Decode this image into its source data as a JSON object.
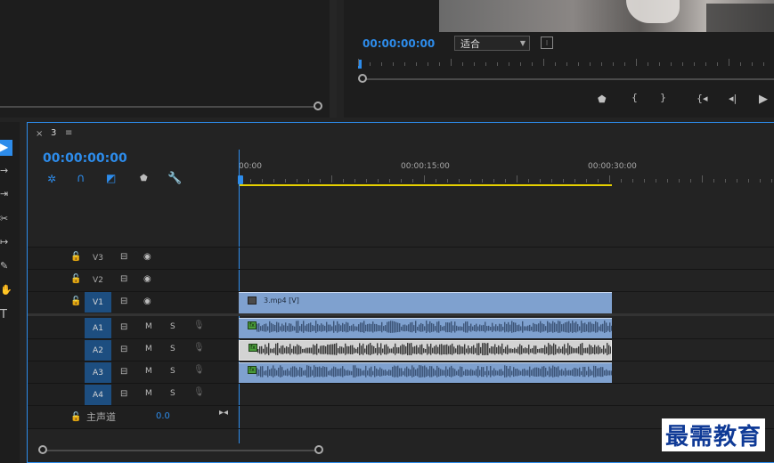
{
  "program": {
    "timecode": "00:00:00:00",
    "zoom_select": "适合",
    "transport": [
      "marker-icon",
      "mark-in-icon",
      "mark-out-icon",
      "go-to-in-icon",
      "step-back-icon",
      "play-icon"
    ]
  },
  "timeline": {
    "tab_close": "×",
    "tab_name": "3",
    "tab_menu": "≡",
    "timecode": "00:00:00:00",
    "ruler": [
      "00:00",
      "00:00:15:00",
      "00:00:30:00"
    ],
    "video_tracks": [
      {
        "name": "V3",
        "active": false
      },
      {
        "name": "V2",
        "active": false
      },
      {
        "name": "V1",
        "active": true
      }
    ],
    "audio_tracks": [
      {
        "name": "A1",
        "active": true,
        "m": "M",
        "s": "S"
      },
      {
        "name": "A2",
        "active": true,
        "m": "M",
        "s": "S"
      },
      {
        "name": "A3",
        "active": true,
        "m": "M",
        "s": "S"
      },
      {
        "name": "A4",
        "active": true,
        "m": "M",
        "s": "S"
      }
    ],
    "master_label": "主声道",
    "master_value": "0.0",
    "video_clip_name": "3.mp4 [V]",
    "fx_badge": "fx"
  },
  "watermark": "最需教育",
  "colors": {
    "accent": "#2d8ceb",
    "clip": "#7fa1cf",
    "work_area": "#e6d000"
  }
}
